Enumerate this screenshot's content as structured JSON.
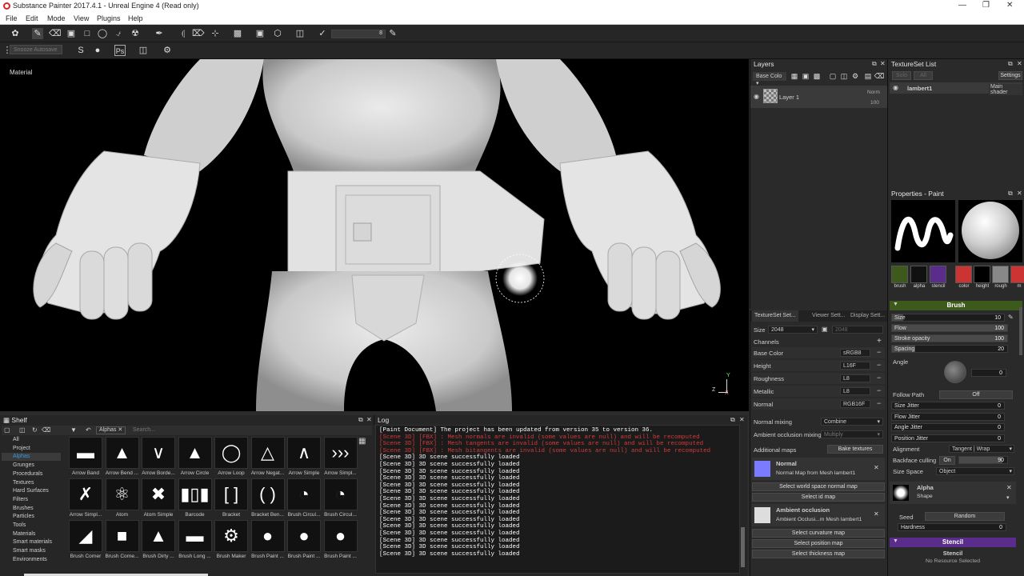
{
  "window": {
    "title": "Substance Painter 2017.4.1 - Unreal Engine 4 (Read only)"
  },
  "menu": [
    "File",
    "Edit",
    "Mode",
    "View",
    "Plugins",
    "Help"
  ],
  "toolbar": {
    "size_value": "8",
    "snooze_placeholder": "Snooze Autosave"
  },
  "viewport": {
    "label": "Material",
    "axis_z": "Z",
    "axis_y": "Y",
    "axis_x": "X"
  },
  "layers": {
    "title": "Layers",
    "channel_select": "Base Colo",
    "layer_name": "Layer 1",
    "blend": "Norm",
    "opacity": "100"
  },
  "texset_tabs": [
    "TextureSet Set...",
    "Viewer Sett...",
    "Display Sett..."
  ],
  "texset": {
    "size_label": "Size",
    "size_value": "2048",
    "size_value2": "2048",
    "channels_label": "Channels",
    "channels": [
      {
        "name": "Base Color",
        "format": "sRGB8"
      },
      {
        "name": "Height",
        "format": "L16F"
      },
      {
        "name": "Roughness",
        "format": "L8"
      },
      {
        "name": "Metallic",
        "format": "L8"
      },
      {
        "name": "Normal",
        "format": "RGB16F"
      }
    ],
    "normal_mixing_label": "Normal mixing",
    "normal_mixing_value": "Combine",
    "ao_mixing_label": "Ambient occlusion mixing",
    "ao_mixing_value": "Multiply",
    "additional_maps_label": "Additional maps",
    "bake_button": "Bake textures",
    "normal_title": "Normal",
    "normal_desc": "Normal Map from Mesh lambert1",
    "select_wsn": "Select world space normal map",
    "select_id": "Select id map",
    "ao_title": "Ambient occlusion",
    "ao_desc": "Ambient Occlusi...m Mesh lambert1",
    "select_curv": "Select curvature map",
    "select_pos": "Select position map",
    "select_thick": "Select thickness map"
  },
  "tslist": {
    "title": "TextureSet List",
    "solo": "Solo",
    "all": "All",
    "settings": "Settings",
    "item": "lambert1",
    "shader": "Main shader"
  },
  "props": {
    "title": "Properties - Paint",
    "slots": [
      "brush",
      "alpha",
      "stencil",
      "color",
      "height",
      "rough",
      "m"
    ],
    "brush_section": "Brush",
    "size_label": "Size",
    "size_value": "10",
    "flow_label": "Flow",
    "flow_value": "100",
    "stroke_label": "Stroke opacity",
    "stroke_value": "100",
    "spacing_label": "Spacing",
    "spacing_value": "20",
    "angle_label": "Angle",
    "angle_value": "0",
    "follow_label": "Follow Path",
    "follow_value": "Off",
    "jitters": [
      {
        "label": "Size Jitter",
        "value": "0"
      },
      {
        "label": "Flow Jitter",
        "value": "0"
      },
      {
        "label": "Angle Jitter",
        "value": "0"
      },
      {
        "label": "Position Jitter",
        "value": "0"
      }
    ],
    "alignment_label": "Alignment",
    "alignment_value": "Tangent | Wrap",
    "backface_label": "Backface culling",
    "backface_toggle": "On",
    "backface_value": "90",
    "sizespace_label": "Size Space",
    "sizespace_value": "Object",
    "alpha_title": "Alpha",
    "alpha_sub": "Shape",
    "seed_label": "Seed",
    "seed_value": "Random",
    "hardness_label": "Hardness",
    "hardness_value": "0",
    "stencil_section": "Stencil",
    "stencil_title": "Stencil",
    "stencil_sub": "No Resource Selected",
    "levels": {
      "size": 0.1,
      "flow": 1.0,
      "stroke": 1.0,
      "spacing": 0.2,
      "backface": 0.9
    }
  },
  "shelf": {
    "title": "Shelf",
    "filter_tag": "Alphas",
    "search_placeholder": "Search...",
    "categories": [
      "All",
      "Project",
      "Alphas",
      "Grunges",
      "Procedurals",
      "Textures",
      "Hard Surfaces",
      "Filters",
      "Brushes",
      "Particles",
      "Tools",
      "Materials",
      "Smart materials",
      "Smart masks",
      "Environments"
    ],
    "items": [
      "Arrow Band",
      "Arrow Bend ...",
      "Arrow Borde...",
      "Arrow Circle",
      "Arrow Loop",
      "Arrow Negat...",
      "Arrow Simple",
      "Arrow Simpl...",
      "Arrow Simpl...",
      "Atom",
      "Atom Simple",
      "Barcode",
      "Bracket",
      "Bracket Ben...",
      "Brush Circul...",
      "Brush Circul...",
      "Brush Corner",
      "Brush Corne...",
      "Brush Dirty ...",
      "Brush Long ...",
      "Brush Maker",
      "Brush Paint ...",
      "Brush Paint ...",
      "Brush Paint ..."
    ]
  },
  "log": {
    "title": "Log",
    "lines": [
      {
        "t": "[Paint Document] The project has been updated from version 35 to version 36.",
        "c": "#ffffff"
      },
      {
        "t": "[Scene 3D] [FBX] : Mesh normals are invalid (some values are null) and will be recomputed",
        "c": "#d23a3a"
      },
      {
        "t": "[Scene 3D] [FBX] : Mesh tangents are invalid (some values are null) and will be recomputed",
        "c": "#d23a3a"
      },
      {
        "t": "[Scene 3D] [FBX] : Mesh bitangents are invalid (some values are null) and will be recomputed",
        "c": "#d23a3a"
      },
      {
        "t": "[Scene 3D] 3D scene successfully loaded",
        "c": "#ffffff"
      },
      {
        "t": "[Scene 3D] 3D scene successfully loaded",
        "c": "#ffffff"
      },
      {
        "t": "[Scene 3D] 3D scene successfully loaded",
        "c": "#ffffff"
      },
      {
        "t": "[Scene 3D] 3D scene successfully loaded",
        "c": "#ffffff"
      },
      {
        "t": "[Scene 3D] 3D scene successfully loaded",
        "c": "#ffffff"
      },
      {
        "t": "[Scene 3D] 3D scene successfully loaded",
        "c": "#ffffff"
      },
      {
        "t": "[Scene 3D] 3D scene successfully loaded",
        "c": "#ffffff"
      },
      {
        "t": "[Scene 3D] 3D scene successfully loaded",
        "c": "#ffffff"
      },
      {
        "t": "[Scene 3D] 3D scene successfully loaded",
        "c": "#ffffff"
      },
      {
        "t": "[Scene 3D] 3D scene successfully loaded",
        "c": "#ffffff"
      },
      {
        "t": "[Scene 3D] 3D scene successfully loaded",
        "c": "#ffffff"
      },
      {
        "t": "[Scene 3D] 3D scene successfully loaded",
        "c": "#ffffff"
      },
      {
        "t": "[Scene 3D] 3D scene successfully loaded",
        "c": "#ffffff"
      },
      {
        "t": "[Scene 3D] 3D scene successfully loaded",
        "c": "#ffffff"
      },
      {
        "t": "[Scene 3D] 3D scene successfully loaded",
        "c": "#ffffff"
      }
    ]
  },
  "colors": {
    "accent_purple": "#5a2d8c",
    "accent_green": "#3d5a1c",
    "normal_swatch": "#7b7bff",
    "shelf_selected": "#3a9ad9"
  }
}
